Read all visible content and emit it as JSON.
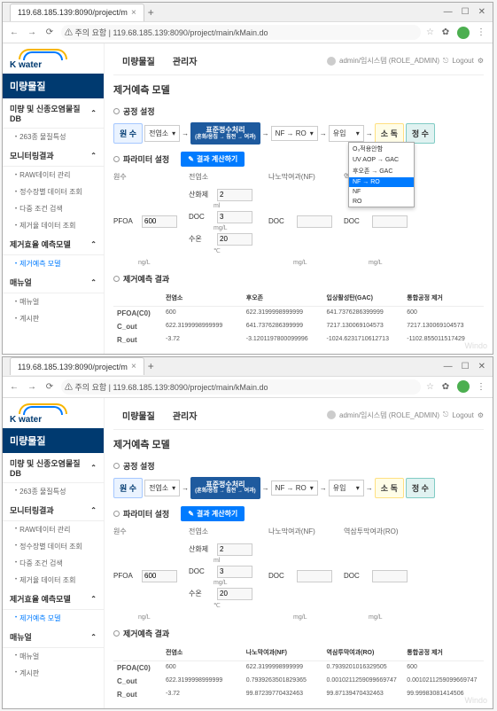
{
  "browser": {
    "tab_title": "119.68.185.139:8090/project/m",
    "security_label": "주의 요함",
    "url": "119.68.185.139:8090/project/main/kMain.do"
  },
  "logo_text": "K water",
  "sidebar": {
    "title": "미량물질",
    "sections": [
      {
        "label": "미량 및 신종오염물질DB",
        "items": [
          {
            "label": "263종 물질특성"
          }
        ]
      },
      {
        "label": "모니터링결과",
        "items": [
          {
            "label": "RAW데이터 관리"
          },
          {
            "label": "정수장별 데이터 조회"
          },
          {
            "label": "다중 조건 검색"
          },
          {
            "label": "제거율 데이터 조회"
          }
        ]
      },
      {
        "label": "제거효율 예측모델",
        "items": [
          {
            "label": "제거예측 모델",
            "active": true
          }
        ]
      },
      {
        "label": "매뉴얼",
        "items": [
          {
            "label": "매뉴얼"
          },
          {
            "label": "계시판"
          }
        ]
      }
    ]
  },
  "top_tabs": [
    "미량물질",
    "관리자"
  ],
  "user": {
    "name": "admin/임시스템 (ROLE_ADMIN)",
    "logout": "Logout"
  },
  "page_title": "제거예측 모델",
  "section_labels": {
    "process": "공정 설정",
    "params": "파라미터 설정",
    "results": "제거예측 결과"
  },
  "process": {
    "raw": "원 수",
    "pre_ozone": "전염소",
    "std_treatment": "표준정수처리",
    "std_treatment_sub": "(혼화/응집 → 침전 → 여과)",
    "nf_ro": "NF → RO",
    "inlet": "유입",
    "disinfection": "소 독",
    "purified": "정 수"
  },
  "dropdown_options": [
    "O₃적용안함",
    "UV AOP → GAC",
    "후오존 → GAC",
    "NF → RO",
    "NF",
    "RO"
  ],
  "calc_button": "결과 계산하기",
  "param_headers": {
    "hwa": "원수",
    "jeon": "전염소",
    "nano": "나노막여과(NF)",
    "reverse": "역삼투막여과(RO)"
  },
  "params": {
    "pfoa_label": "PFOA",
    "pfoa_value": "600",
    "pfoa_unit": "ng/L",
    "sanhwa_label": "산화제",
    "sanhwa_value": "2",
    "sanhwa_unit": "ml",
    "doc_label": "DOC",
    "doc_value": "3",
    "doc_unit": "mg/L",
    "sugeon_label": "수온",
    "sugeon_value": "20",
    "sugeon_unit": "℃",
    "doc_n_label": "DOC",
    "doc_n_unit": "mg/L",
    "doc_r_label": "DOC",
    "doc_r_unit": "mg/L"
  },
  "results1": {
    "headers": [
      "",
      "전염소",
      "후오존",
      "입상활성탄(GAC)",
      "통합공정 제거"
    ],
    "rows": [
      {
        "label": "PFOA(C0)",
        "vals": [
          "600",
          "622.3199998999999",
          "641.7376286399999",
          "600"
        ]
      },
      {
        "label": "C_out",
        "vals": [
          "622.3199998999999",
          "641.7376286399999",
          "7217.130069104573",
          "7217.130069104573"
        ]
      },
      {
        "label": "R_out",
        "vals": [
          "-3.72",
          "-3.1201197800099996",
          "-1024.6231710612713",
          "-1102.855011517429"
        ]
      }
    ]
  },
  "results2": {
    "headers": [
      "",
      "전염소",
      "나노막여과(NF)",
      "역삼투막여과(RO)",
      "통합공정 제거"
    ],
    "rows": [
      {
        "label": "PFOA(C0)",
        "vals": [
          "600",
          "622.3199998999999",
          "0.7939201016329505",
          "600"
        ]
      },
      {
        "label": "C_out",
        "vals": [
          "622.3199998999999",
          "0.7939263501829365",
          "0.0010211259099669747",
          "0.0010211259099669747"
        ]
      },
      {
        "label": "R_out",
        "vals": [
          "-3.72",
          "99.87239770432463",
          "99.87139470432463",
          "99.99983081414506"
        ]
      }
    ]
  }
}
